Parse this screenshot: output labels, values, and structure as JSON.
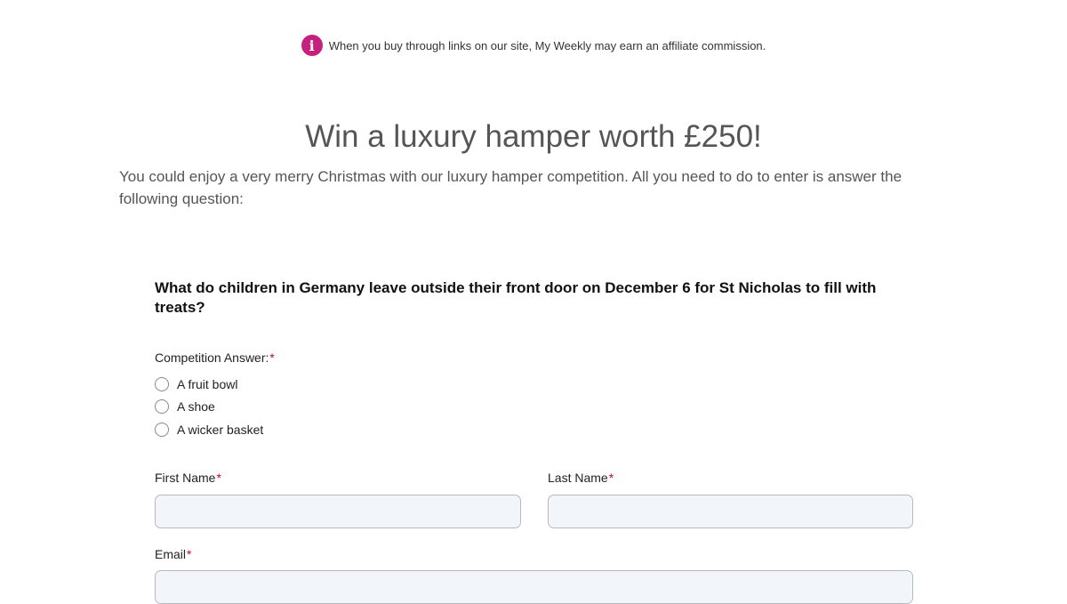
{
  "affiliate_notice": {
    "icon": "info-icon",
    "icon_glyph": "i",
    "icon_color": "#c4227e",
    "text": "When you buy through links on our site, My Weekly may earn an affiliate commission."
  },
  "article": {
    "title": "Win a luxury hamper worth £250!",
    "intro": "You could enjoy a very merry Christmas with our luxury hamper competition. All you need to do to enter is answer the following question:"
  },
  "form": {
    "question": "What do children in Germany leave outside their front door on December 6 for St Nicholas to fill with treats?",
    "answer_label": "Competition Answer:",
    "required_marker": "*",
    "options": [
      "A fruit bowl",
      "A shoe",
      "A wicker basket"
    ],
    "first_name_label": "First Name",
    "last_name_label": "Last Name",
    "email_label": "Email",
    "first_name_value": "",
    "last_name_value": "",
    "email_value": ""
  }
}
